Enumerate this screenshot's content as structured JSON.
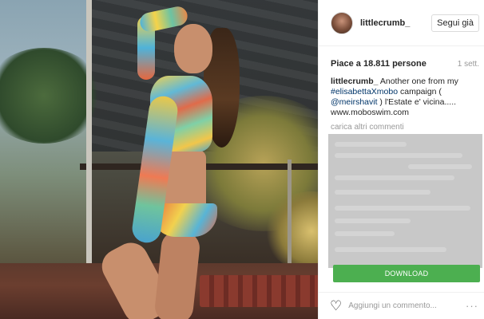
{
  "post": {
    "username": "littlecrumb_",
    "follow_label": "Segui già",
    "likes": "Piace a 18.811 persone",
    "age": "1 sett.",
    "caption": {
      "username": "littlecrumb_",
      "text1": " Another one from my ",
      "hashtag": "#elisabettaXmobo",
      "text2": " campaign ( ",
      "mention": "@meirshavit",
      "text3": " ) l'Estate e' vicina.....",
      "website": "www.moboswim.com"
    },
    "load_more": "carica altri commenti",
    "download_label": "DOWNLOAD",
    "comment_placeholder": "Aggiungi un commento...",
    "more_icon": "···"
  },
  "icons": {
    "like": "heart-icon",
    "options": "more-options-icon"
  },
  "colors": {
    "download_green": "#4caf50",
    "link_blue": "#003569",
    "overlay_gray": "#c8c8c8"
  }
}
